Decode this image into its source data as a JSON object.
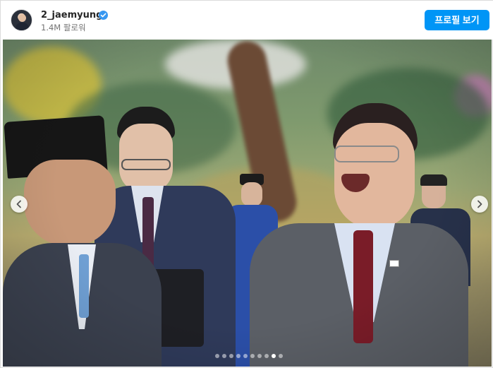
{
  "post_header": {
    "username": "2_jaemyung",
    "followers": "1.4M 팔로워",
    "profile_button": "프로필 보기"
  },
  "carousel": {
    "slide_count": 10,
    "active_index": 8
  },
  "colors": {
    "accent": "#0095f6",
    "verified": "#3897f0"
  },
  "icons": {
    "verified": "verified-badge-icon",
    "prev": "chevron-left-icon",
    "next": "chevron-right-icon"
  }
}
